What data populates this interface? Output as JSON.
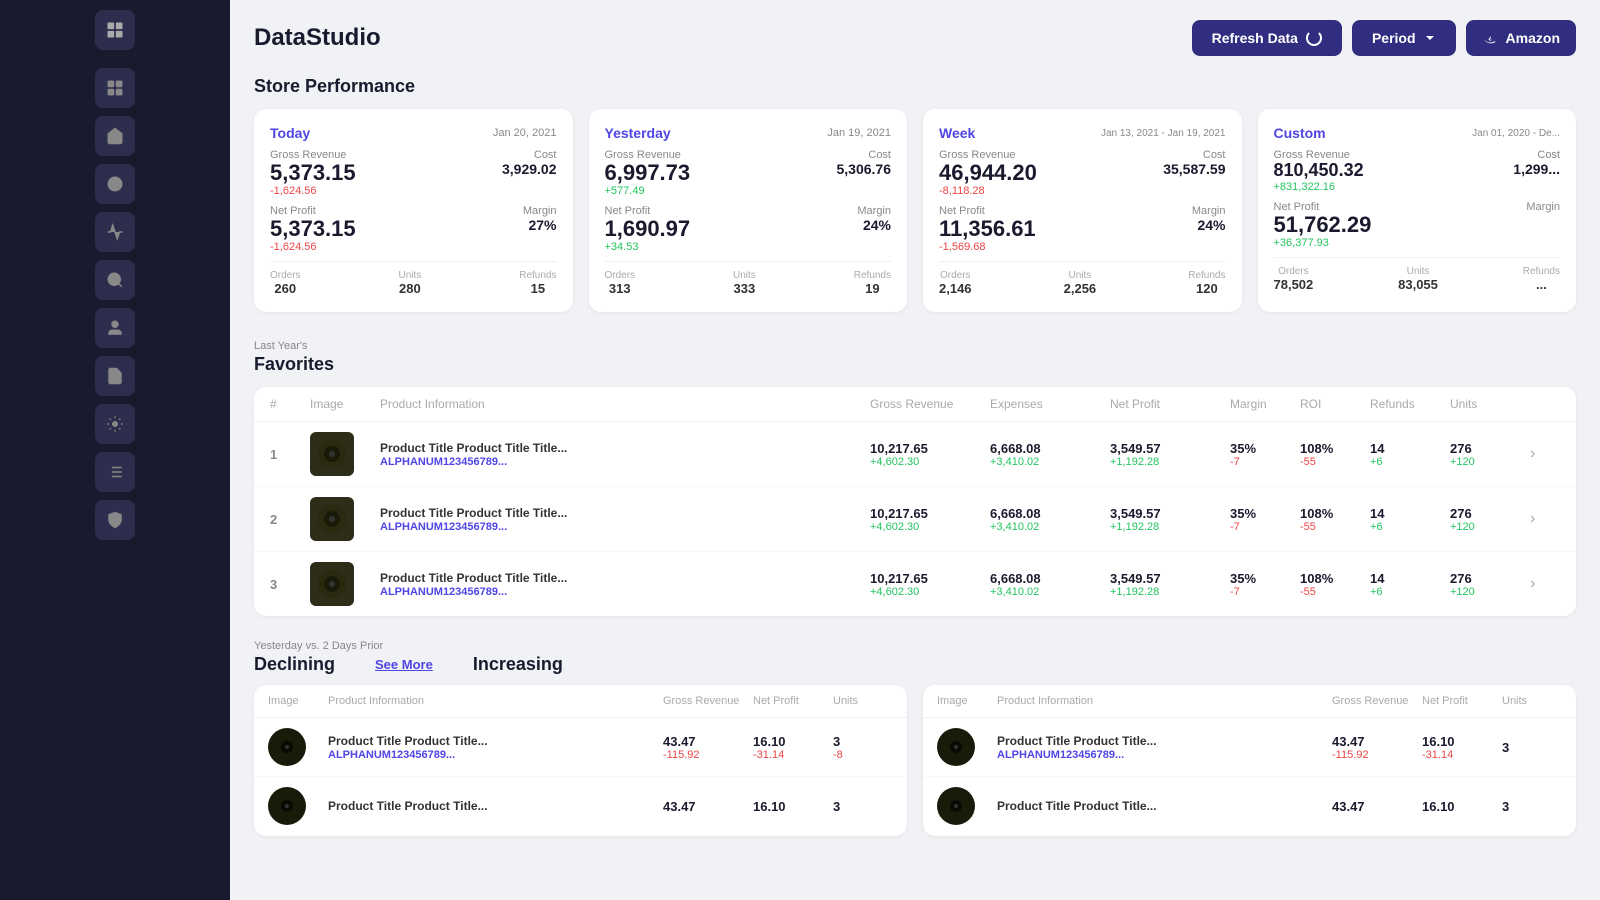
{
  "app": {
    "title": "DataStudio"
  },
  "header": {
    "refresh_label": "Refresh Data",
    "period_label": "Period",
    "amazon_label": "Amazon"
  },
  "store_performance": {
    "title": "Store Performance",
    "cards": [
      {
        "tab": "Today",
        "date": "Jan 20, 2021",
        "gross_revenue_label": "Gross Revenue",
        "cost_label": "Cost",
        "gross_revenue": "5,373.15",
        "cost": "3,929.02",
        "delta_revenue": "-1,624.56",
        "delta_revenue_type": "neg",
        "net_profit_label": "Net Profit",
        "margin_label": "Margin",
        "net_profit": "5,373.15",
        "margin": "27%",
        "delta_profit": "-1,624.56",
        "delta_profit_type": "neg",
        "orders_label": "Orders",
        "units_label": "Units",
        "refunds_label": "Refunds",
        "orders": "260",
        "units": "280",
        "refunds": "15"
      },
      {
        "tab": "Yesterday",
        "date": "Jan 19, 2021",
        "gross_revenue_label": "Gross Revenue",
        "cost_label": "Cost",
        "gross_revenue": "6,997.73",
        "cost": "5,306.76",
        "delta_revenue": "+577.49",
        "delta_revenue_type": "pos",
        "net_profit_label": "Net Profit",
        "margin_label": "Margin",
        "net_profit": "1,690.97",
        "margin": "24%",
        "delta_profit": "+34.53",
        "delta_profit_type": "pos",
        "orders_label": "Orders",
        "units_label": "Units",
        "refunds_label": "Refunds",
        "orders": "313",
        "units": "333",
        "refunds": "19"
      },
      {
        "tab": "Week",
        "date": "Jan 13, 2021 - Jan 19, 2021",
        "gross_revenue_label": "Gross Revenue",
        "cost_label": "Cost",
        "gross_revenue": "46,944.20",
        "cost": "35,587.59",
        "delta_revenue": "-8,118.28",
        "delta_revenue_type": "neg",
        "net_profit_label": "Net Profit",
        "margin_label": "Margin",
        "net_profit": "11,356.61",
        "margin": "24%",
        "delta_profit": "-1,569.68",
        "delta_profit_type": "neg",
        "orders_label": "Orders",
        "units_label": "Units",
        "refunds_label": "Refunds",
        "orders": "2,146",
        "units": "2,256",
        "refunds": "120"
      },
      {
        "tab": "Custom",
        "date": "Jan 01, 2020 - De...",
        "gross_revenue_label": "Gross Revenue",
        "cost_label": "Cost",
        "gross_revenue": "810,450.32",
        "cost": "1,299...",
        "delta_revenue": "+831,322.16",
        "delta_revenue_type": "pos",
        "net_profit_label": "Net Profit",
        "margin_label": "Margin",
        "net_profit": "51,762.29",
        "margin": "",
        "delta_profit": "+36,377.93",
        "delta_profit_type": "pos",
        "orders_label": "Orders",
        "units_label": "Units",
        "refunds_label": "Refunds",
        "orders": "78,502",
        "units": "83,055",
        "refunds": "..."
      }
    ]
  },
  "favorites": {
    "section_sub": "Last Year's",
    "title": "Favorites",
    "columns": [
      "#",
      "Image",
      "Product Information",
      "Gross Revenue",
      "Expenses",
      "Net Profit",
      "Margin",
      "ROI",
      "Refunds",
      "Units"
    ],
    "rows": [
      {
        "num": "1",
        "title": "Product Title Product Title Title...",
        "sku": "ALPHANUM123456789...",
        "gross_revenue": "10,217.65",
        "gross_delta": "+4,602.30",
        "expenses": "6,668.08",
        "expenses_delta": "+3,410.02",
        "net_profit": "3,549.57",
        "net_delta": "+1,192.28",
        "margin": "35%",
        "margin_delta": "-7",
        "roi": "108%",
        "roi_delta": "-55",
        "refunds": "14",
        "refunds_delta": "+6",
        "units": "276",
        "units_delta": "+120"
      },
      {
        "num": "2",
        "title": "Product Title Product Title Title...",
        "sku": "ALPHANUM123456789...",
        "gross_revenue": "10,217.65",
        "gross_delta": "+4,602.30",
        "expenses": "6,668.08",
        "expenses_delta": "+3,410.02",
        "net_profit": "3,549.57",
        "net_delta": "+1,192.28",
        "margin": "35%",
        "margin_delta": "-7",
        "roi": "108%",
        "roi_delta": "-55",
        "refunds": "14",
        "refunds_delta": "+6",
        "units": "276",
        "units_delta": "+120"
      },
      {
        "num": "3",
        "title": "Product Title Product Title Title...",
        "sku": "ALPHANUM123456789...",
        "gross_revenue": "10,217.65",
        "gross_delta": "+4,602.30",
        "expenses": "6,668.08",
        "expenses_delta": "+3,410.02",
        "net_profit": "3,549.57",
        "net_delta": "+1,192.28",
        "margin": "35%",
        "margin_delta": "-7",
        "roi": "108%",
        "roi_delta": "-55",
        "refunds": "14",
        "refunds_delta": "+6",
        "units": "276",
        "units_delta": "+120"
      }
    ]
  },
  "declining": {
    "section_sub": "Yesterday vs. 2 Days Prior",
    "title": "Declining",
    "see_more": "See More",
    "increasing_title": "Increasing",
    "columns": [
      "Image",
      "Product Information",
      "Gross Revenue",
      "Net Profit",
      "Units"
    ],
    "rows": [
      {
        "title": "Product Title Product Title...",
        "sku": "ALPHANUM123456789...",
        "gross_revenue": "43.47",
        "gross_delta": "-115.92",
        "net_profit": "16.10",
        "net_delta": "-31.14",
        "units": "3",
        "units_delta": "-8"
      },
      {
        "title": "Product Title Product Title...",
        "sku": "",
        "gross_revenue": "43.47",
        "gross_delta": "",
        "net_profit": "16.10",
        "net_delta": "",
        "units": "3",
        "units_delta": ""
      }
    ],
    "inc_rows": [
      {
        "title": "Product Title Product Title...",
        "sku": "ALPHANUM123456789...",
        "gross_revenue": "43.47",
        "gross_delta": "-115.92",
        "net_profit": "16.10",
        "net_delta": "-31.14",
        "units": "3",
        "units_delta": ""
      },
      {
        "title": "Product Title Product Title...",
        "sku": "",
        "gross_revenue": "43.47",
        "gross_delta": "",
        "net_profit": "16.10",
        "net_delta": "",
        "units": "3",
        "units_delta": ""
      }
    ]
  },
  "sidebar": {
    "items_count": 10
  }
}
